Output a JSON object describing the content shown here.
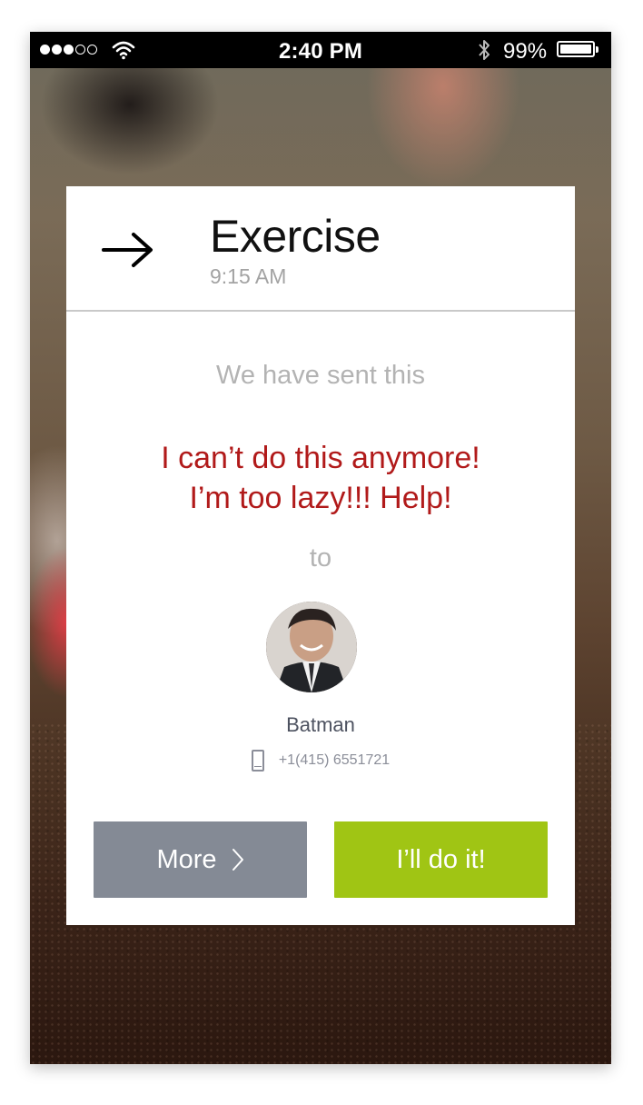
{
  "status_bar": {
    "signal_dots": [
      "full",
      "full",
      "full",
      "empty",
      "empty"
    ],
    "time": "2:40 PM",
    "battery_percent": "99%",
    "icons": [
      "wifi-icon",
      "bluetooth-icon",
      "battery-icon"
    ]
  },
  "card": {
    "icon": "arrow-right-icon",
    "title": "Exercise",
    "time": "9:15 AM",
    "sent_label": "We have sent this",
    "message_line1": "I can’t do this anymore!",
    "message_line2": "I’m too lazy!!! Help!",
    "to_label": "to",
    "contact": {
      "name": "Batman",
      "phone": "+1(415) 6551721"
    },
    "buttons": {
      "more_label": "More",
      "doit_label": "I’ll do it!"
    }
  },
  "colors": {
    "message": "#b11a1a",
    "more_button": "#848a95",
    "doit_button": "#a0c514",
    "muted_text": "#b3b3b3"
  }
}
